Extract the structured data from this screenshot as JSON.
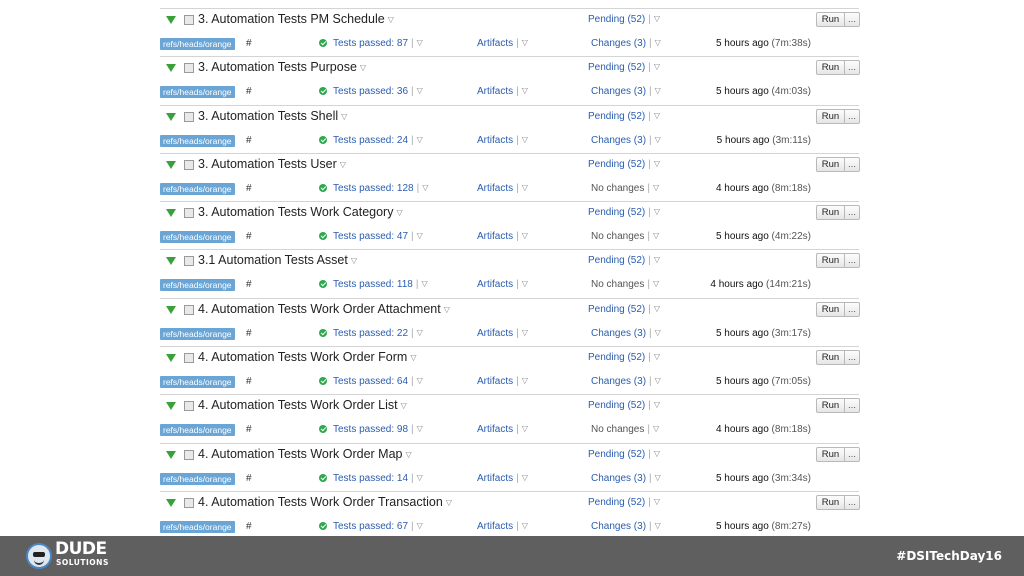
{
  "builds": [
    {
      "name": "3. Automation Tests PM Schedule",
      "pending": "Pending (52)",
      "run_label": "Run",
      "more_label": "...",
      "branch": "refs/heads/orange",
      "hash": "#",
      "status": "Tests passed: 87",
      "artifacts": "Artifacts",
      "changes": "Changes (3)",
      "time_ago": "5 hours ago",
      "duration": "(7m:38s)"
    },
    {
      "name": "3. Automation Tests Purpose",
      "pending": "Pending (52)",
      "run_label": "Run",
      "more_label": "...",
      "branch": "refs/heads/orange",
      "hash": "#",
      "status": "Tests passed: 36",
      "artifacts": "Artifacts",
      "changes": "Changes (3)",
      "time_ago": "5 hours ago",
      "duration": "(4m:03s)"
    },
    {
      "name": "3. Automation Tests Shell",
      "pending": "Pending (52)",
      "run_label": "Run",
      "more_label": "...",
      "branch": "refs/heads/orange",
      "hash": "#",
      "status": "Tests passed: 24",
      "artifacts": "Artifacts",
      "changes": "Changes (3)",
      "time_ago": "5 hours ago",
      "duration": "(3m:11s)"
    },
    {
      "name": "3. Automation Tests User",
      "pending": "Pending (52)",
      "run_label": "Run",
      "more_label": "...",
      "branch": "refs/heads/orange",
      "hash": "#",
      "status": "Tests passed: 128",
      "artifacts": "Artifacts",
      "changes": "No changes",
      "time_ago": "4 hours ago",
      "duration": "(8m:18s)"
    },
    {
      "name": "3. Automation Tests Work Category",
      "pending": "Pending (52)",
      "run_label": "Run",
      "more_label": "...",
      "branch": "refs/heads/orange",
      "hash": "#",
      "status": "Tests passed: 47",
      "artifacts": "Artifacts",
      "changes": "No changes",
      "time_ago": "5 hours ago",
      "duration": "(4m:22s)"
    },
    {
      "name": "3.1 Automation Tests Asset",
      "pending": "Pending (52)",
      "run_label": "Run",
      "more_label": "...",
      "branch": "refs/heads/orange",
      "hash": "#",
      "status": "Tests passed: 118",
      "artifacts": "Artifacts",
      "changes": "No changes",
      "time_ago": "4 hours ago",
      "duration": "(14m:21s)"
    },
    {
      "name": "4. Automation Tests Work Order Attachment",
      "pending": "Pending (52)",
      "run_label": "Run",
      "more_label": "...",
      "branch": "refs/heads/orange",
      "hash": "#",
      "status": "Tests passed: 22",
      "artifacts": "Artifacts",
      "changes": "Changes (3)",
      "time_ago": "5 hours ago",
      "duration": "(3m:17s)"
    },
    {
      "name": "4. Automation Tests Work Order Form",
      "pending": "Pending (52)",
      "run_label": "Run",
      "more_label": "...",
      "branch": "refs/heads/orange",
      "hash": "#",
      "status": "Tests passed: 64",
      "artifacts": "Artifacts",
      "changes": "Changes (3)",
      "time_ago": "5 hours ago",
      "duration": "(7m:05s)"
    },
    {
      "name": "4. Automation Tests Work Order List",
      "pending": "Pending (52)",
      "run_label": "Run",
      "more_label": "...",
      "branch": "refs/heads/orange",
      "hash": "#",
      "status": "Tests passed: 98",
      "artifacts": "Artifacts",
      "changes": "No changes",
      "time_ago": "4 hours ago",
      "duration": "(8m:18s)"
    },
    {
      "name": "4. Automation Tests Work Order Map",
      "pending": "Pending (52)",
      "run_label": "Run",
      "more_label": "...",
      "branch": "refs/heads/orange",
      "hash": "#",
      "status": "Tests passed: 14",
      "artifacts": "Artifacts",
      "changes": "Changes (3)",
      "time_ago": "5 hours ago",
      "duration": "(3m:34s)"
    },
    {
      "name": "4. Automation Tests Work Order Transaction",
      "pending": "Pending (52)",
      "run_label": "Run",
      "more_label": "...",
      "branch": "refs/heads/orange",
      "hash": "#",
      "status": "Tests passed: 67",
      "artifacts": "Artifacts",
      "changes": "Changes (3)",
      "time_ago": "5 hours ago",
      "duration": "(8m:27s)"
    }
  ],
  "footer": {
    "logo_word": "DUDE",
    "logo_sub": "SOLUTIONS",
    "hashtag": "#DSITechDay16"
  },
  "colors": {
    "link": "#2a5db0",
    "success": "#2fa84f",
    "branch_badge": "#6aa5d6",
    "footer_bg": "#5f5f5f"
  }
}
